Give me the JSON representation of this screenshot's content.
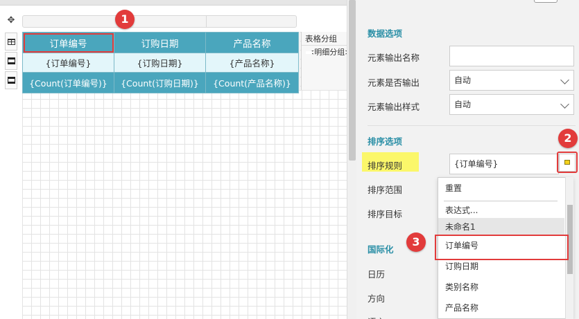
{
  "designer": {
    "table": {
      "headers": [
        "订单编号",
        "订购日期",
        "产品名称"
      ],
      "detail": [
        "{订单编号}",
        "{订购日期}",
        "{产品名称}"
      ],
      "totals": [
        "{Count(订单编号)}",
        "{Count(订购日期)}",
        "{Count(产品名称)}"
      ]
    },
    "group_panel": {
      "title": "表格分组",
      "item": "<明细分组>"
    }
  },
  "panel": {
    "data_options": {
      "title": "数据选项",
      "output_name_label": "元素输出名称",
      "output_name_value": "",
      "output_enabled_label": "元素是否输出",
      "output_enabled_value": "自动",
      "output_style_label": "元素输出样式",
      "output_style_value": "自动"
    },
    "sort_options": {
      "title": "排序选项",
      "rule_label": "排序规则",
      "rule_value": "{订单编号}",
      "range_label": "排序范围",
      "target_label": "排序目标"
    },
    "i18n": {
      "title": "国际化",
      "calendar_label": "日历",
      "direction_label": "方向",
      "language_label": "语言"
    }
  },
  "dropdown": {
    "options": [
      "重置",
      "表达式...",
      "未命名1",
      "订单编号",
      "订购日期",
      "类别名称",
      "产品名称"
    ]
  },
  "badges": [
    "1",
    "2",
    "3"
  ],
  "colors": {
    "header_teal": "#4aa6bd",
    "section_title": "#2a8fa6",
    "highlight_yellow": "#fbf76a",
    "callout_red": "#e23b3b"
  }
}
